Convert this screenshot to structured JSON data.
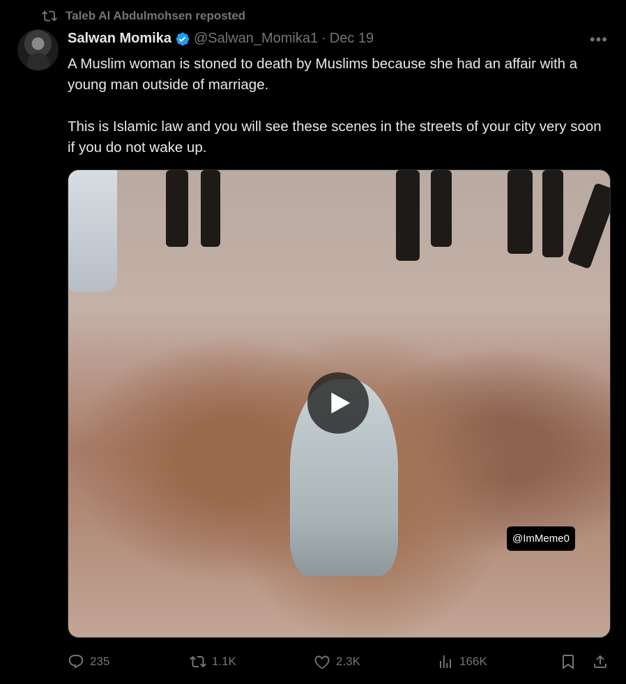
{
  "repost": {
    "label": "Taleb Al Abdulmohsen reposted",
    "icon": "repost-icon"
  },
  "author": {
    "name": "Salwan Momika",
    "handle": "@Salwan_Momika1",
    "separator": "·",
    "date": "Dec 19",
    "verified_icon": "verified-badge-icon",
    "verified_color": "#1d9bf0"
  },
  "more_label": "•••",
  "tweet": {
    "paragraphs": [
      "A Muslim woman is stoned to death by Muslims because she had an affair with a young man outside of marriage.",
      "This is Islamic law and you will see these scenes in the streets of your city very soon if you do not wake up."
    ]
  },
  "media": {
    "watermark": "@ImMeme0",
    "play_icon": "play-icon"
  },
  "actions": {
    "replies": "235",
    "reposts": "1.1K",
    "likes": "2.3K",
    "views": "166K"
  },
  "colors": {
    "background": "#000000",
    "text": "#e7e9ea",
    "muted": "#71767b"
  }
}
